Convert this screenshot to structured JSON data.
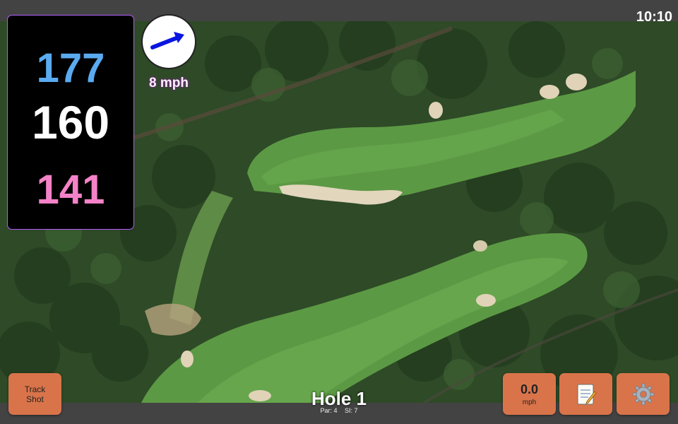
{
  "status": {
    "time": "10:10"
  },
  "distances": {
    "back": "177",
    "middle": "160",
    "front": "141"
  },
  "wind": {
    "speed": "8 mph",
    "icon": "wind-direction-arrow-icon"
  },
  "hole": {
    "title": "Hole 1",
    "par": "Par: 4",
    "si": "SI: 7"
  },
  "buttons": {
    "track_line1": "Track",
    "track_line2": "Shot",
    "speed_value": "0.0",
    "speed_unit": "mph",
    "notes_icon": "notepad-icon",
    "settings_icon": "gear-icon"
  },
  "colors": {
    "button_bg": "#d9744a",
    "back_distance": "#5aaaf0",
    "middle_distance": "#ffffff",
    "front_distance": "#f582c8",
    "wind_arrow": "#0a16e0"
  }
}
